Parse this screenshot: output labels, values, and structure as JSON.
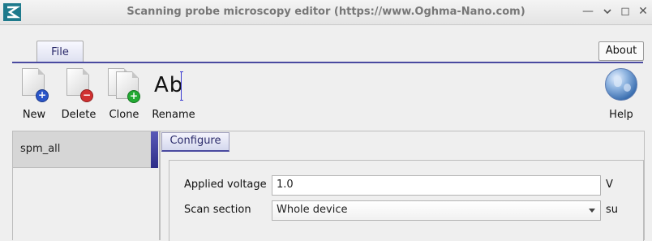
{
  "window": {
    "title": "Scanning probe microscopy editor (https://www.Oghma-Nano.com)",
    "controls": {
      "minimize": "—",
      "restore": "◻",
      "close": "✕"
    }
  },
  "menu": {
    "tabs": [
      {
        "label": "File"
      }
    ],
    "about_label": "About"
  },
  "toolbar": {
    "new_label": "New",
    "delete_label": "Delete",
    "clone_label": "Clone",
    "rename_label": "Rename",
    "rename_glyph": "Ab",
    "help_label": "Help",
    "icons": {
      "new": "new-file-icon",
      "delete": "delete-file-icon",
      "clone": "clone-file-icon",
      "rename": "rename-icon",
      "help": "help-globe-icon"
    }
  },
  "list": {
    "items": [
      {
        "label": "spm_all",
        "selected": true
      }
    ]
  },
  "editor": {
    "tab_label": "Configure",
    "fields": [
      {
        "label": "Applied voltage",
        "value": "1.0",
        "unit": "V",
        "kind": "text"
      },
      {
        "label": "Scan section",
        "value": "Whole device",
        "unit": "su",
        "kind": "select"
      }
    ]
  },
  "colors": {
    "accent": "#4a4aa0",
    "add_badge": "#22aa33",
    "new_badge": "#2a55c8",
    "delete_badge": "#d03030"
  }
}
